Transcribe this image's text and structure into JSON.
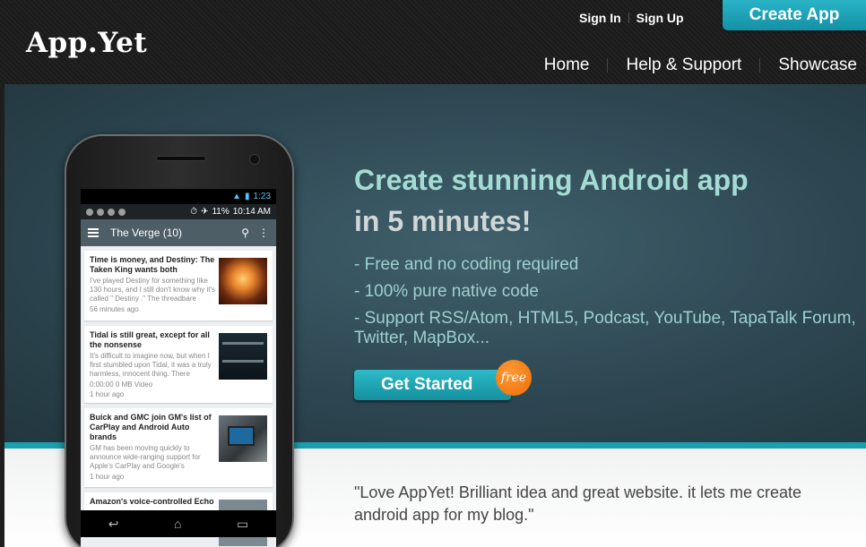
{
  "header": {
    "logo": "App.Yet",
    "sign_in": "Sign In",
    "sign_up": "Sign Up",
    "create_app": "Create App",
    "nav": [
      "Home",
      "Help & Support",
      "Showcase"
    ]
  },
  "hero": {
    "title_line1": "Create stunning Android app",
    "title_line2": "in 5 minutes!",
    "features": [
      "- Free and no coding required",
      "- 100% pure native code",
      "- Support RSS/Atom, HTML5, Podcast, YouTube, TapaTalk Forum, Twitter, MapBox..."
    ],
    "cta": "Get Started",
    "badge": "free"
  },
  "testimonial": {
    "quote": "\"Love AppYet! Brilliant idea and great website. it lets me create android app for my blog.\""
  },
  "phone": {
    "status_time": "1:23",
    "notif_battery": "11%",
    "notif_time": "10:14 AM",
    "app_title": "The Verge (10)",
    "cards": [
      {
        "title": "Time is money, and Destiny: The Taken King wants both",
        "snippet": "I've played Destiny for something like 130 hours, and I still don't know why it's called \" Destiny .\" The threadbare",
        "meta": "56 minutes ago"
      },
      {
        "title": "Tidal is still great, except for all the nonsense",
        "snippet": "It's difficult to imagine now, but when I first stumbled upon Tidal, it was a truly harmless, innocent thing. There",
        "media": "0:00:00  0 MB  Video",
        "meta": "1 hour ago"
      },
      {
        "title": "Buick and GMC join GM's list of CarPlay and Android Auto brands",
        "snippet": "GM has been moving quickly to announce wide-ranging support for Apple's CarPlay and Google's",
        "meta": "1 hour ago"
      },
      {
        "title": "Amazon's voice-controlled Echo"
      }
    ]
  },
  "colors": {
    "accent": "#1aa0b1",
    "title_teal": "#a4dcd3",
    "badge_orange": "#ee6d07"
  }
}
